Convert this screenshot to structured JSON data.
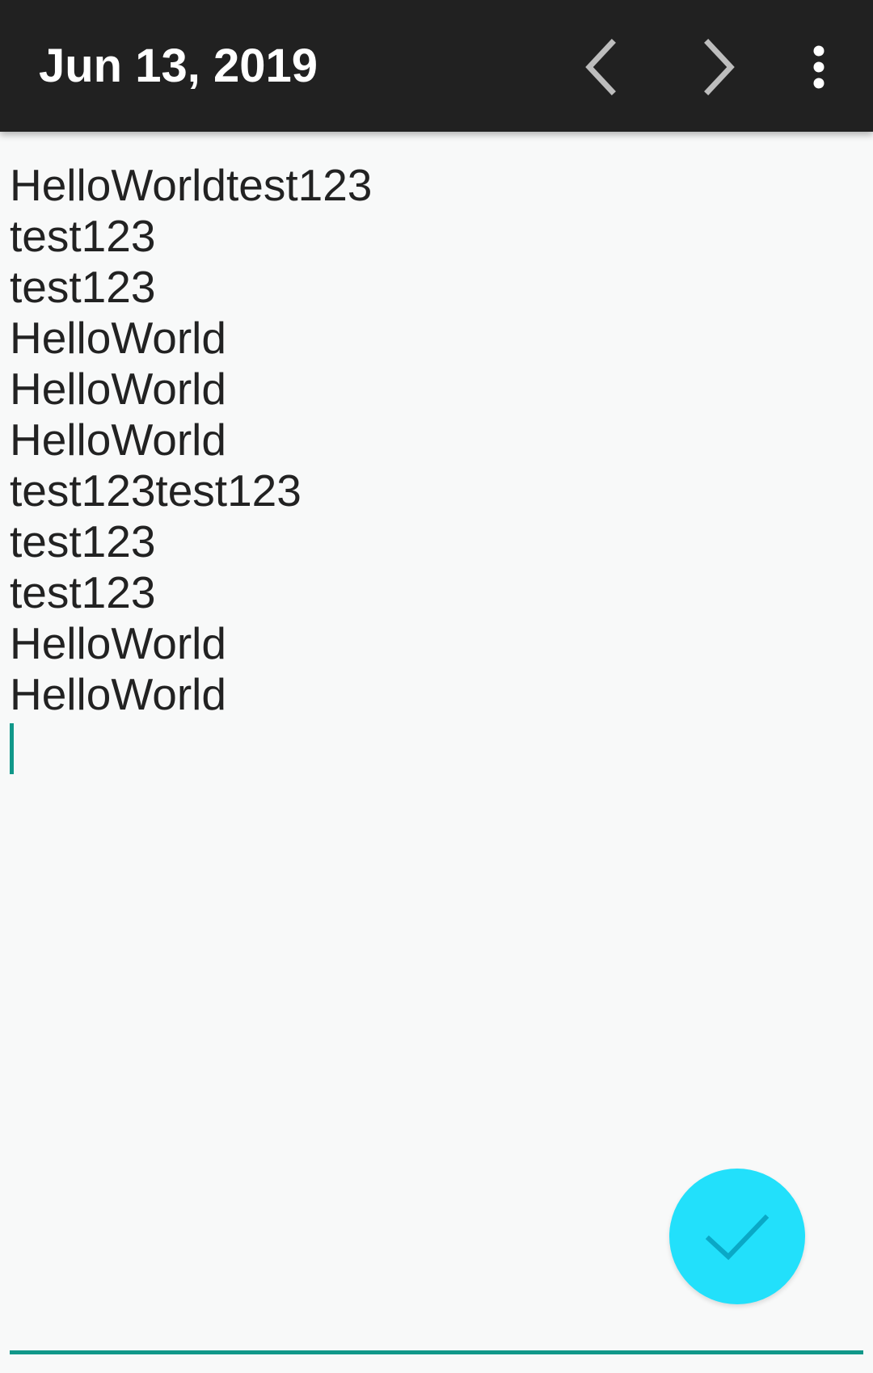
{
  "toolbar": {
    "title": "Jun 13, 2019",
    "prev_icon": "chevron-left-icon",
    "next_icon": "chevron-right-icon",
    "more_icon": "more-vertical-icon"
  },
  "editor": {
    "text": "HelloWorldtest123\ntest123\ntest123\nHelloWorld\nHelloWorld\nHelloWorld\ntest123test123\ntest123\ntest123\nHelloWorld\nHelloWorld"
  },
  "fab": {
    "icon": "check-icon"
  },
  "colors": {
    "toolbar_bg": "#212121",
    "background": "#f8f9f9",
    "accent": "#11988a",
    "fab": "#22e0fb"
  }
}
